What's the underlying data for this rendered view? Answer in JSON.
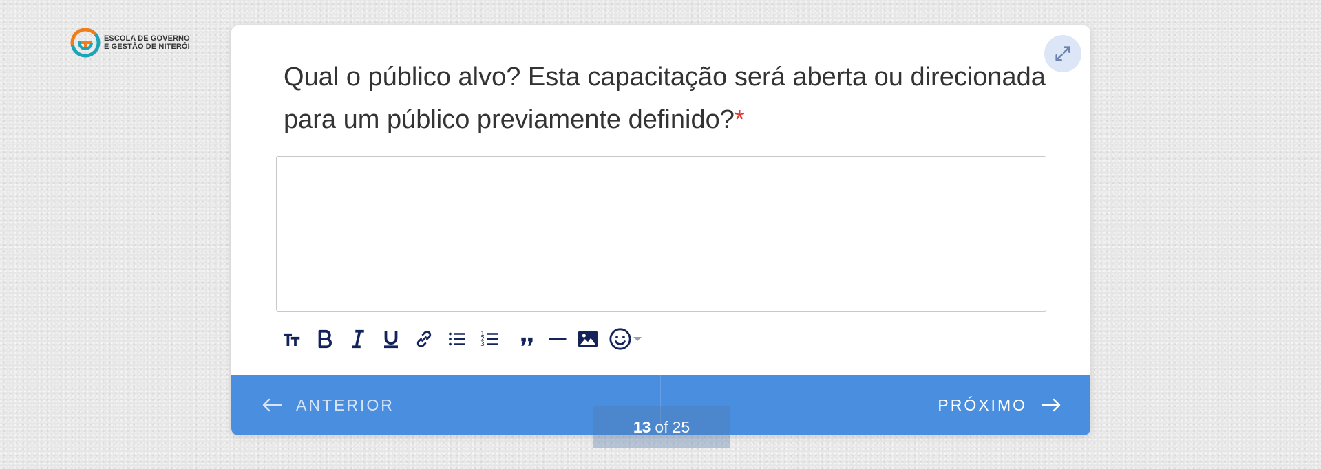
{
  "logo": {
    "line1": "ESCOLA DE GOVERNO",
    "line2": "E GESTÃO DE NITERÓI",
    "colors": {
      "teal": "#1aa5b8",
      "orange": "#f07d1a"
    }
  },
  "question": {
    "text": "Qual o público alvo? Esta capacitação será aberta ou direcionada para um público previamente definido?",
    "required_mark": "*"
  },
  "answer": {
    "value": ""
  },
  "toolbar": {
    "items": [
      "text-size-icon",
      "bold-icon",
      "italic-icon",
      "underline-icon",
      "link-icon",
      "bullet-list-icon",
      "numbered-list-icon",
      "quote-icon",
      "horizontal-rule-icon",
      "image-icon",
      "emoji-icon"
    ]
  },
  "nav": {
    "prev_label": "ANTERIOR",
    "next_label": "PRÓXIMO"
  },
  "progress": {
    "current": "13",
    "of": "of",
    "total": "25"
  },
  "colors": {
    "accent": "#4a8ee0",
    "required": "#e53935",
    "icon": "#14245a"
  }
}
